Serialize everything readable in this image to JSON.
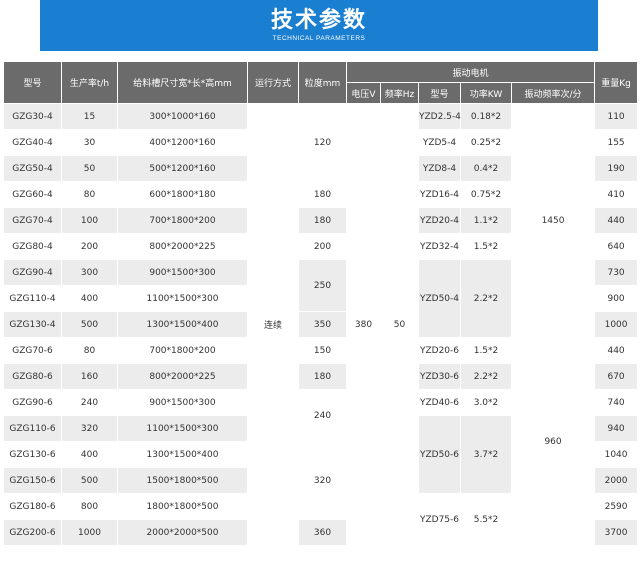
{
  "banner": {
    "title": "技术参数",
    "subtitle": "TECHNICAL PARAMETERS"
  },
  "headers": {
    "model": "型号",
    "capacity": "生产率t/h",
    "trough": "给料槽尺寸宽*长*高mm",
    "mode": "运行方式",
    "granularity": "粒度mm",
    "motor": "振动电机",
    "voltage": "电压V",
    "frequency": "频率Hz",
    "motor_model": "型号",
    "power": "功率KW",
    "vib_freq": "振动频率次/分",
    "weight": "重量Kg"
  },
  "shared": {
    "mode": "连续",
    "voltage": "380",
    "frequency": "50",
    "vib_freq_4": "1450",
    "vib_freq_6": "960"
  },
  "rows": [
    {
      "model": "GZG30-4",
      "capacity": "15",
      "trough": "300*1000*160",
      "weight": "110"
    },
    {
      "model": "GZG40-4",
      "capacity": "30",
      "trough": "400*1200*160",
      "weight": "155"
    },
    {
      "model": "GZG50-4",
      "capacity": "50",
      "trough": "500*1200*160",
      "weight": "190"
    },
    {
      "model": "GZG60-4",
      "capacity": "80",
      "trough": "600*1800*180",
      "weight": "410"
    },
    {
      "model": "GZG70-4",
      "capacity": "100",
      "trough": "700*1800*200",
      "weight": "440"
    },
    {
      "model": "GZG80-4",
      "capacity": "200",
      "trough": "800*2000*225",
      "weight": "640"
    },
    {
      "model": "GZG90-4",
      "capacity": "300",
      "trough": "900*1500*300",
      "weight": "730"
    },
    {
      "model": "GZG110-4",
      "capacity": "400",
      "trough": "1100*1500*300",
      "weight": "900"
    },
    {
      "model": "GZG130-4",
      "capacity": "500",
      "trough": "1300*1500*400",
      "weight": "1000"
    },
    {
      "model": "GZG70-6",
      "capacity": "80",
      "trough": "700*1800*200",
      "weight": "440"
    },
    {
      "model": "GZG80-6",
      "capacity": "160",
      "trough": "800*2000*225",
      "weight": "670"
    },
    {
      "model": "GZG90-6",
      "capacity": "240",
      "trough": "900*1500*300",
      "weight": "740"
    },
    {
      "model": "GZG110-6",
      "capacity": "320",
      "trough": "1100*1500*300",
      "weight": "940"
    },
    {
      "model": "GZG130-6",
      "capacity": "400",
      "trough": "1300*1500*400",
      "weight": "1040"
    },
    {
      "model": "GZG150-6",
      "capacity": "500",
      "trough": "1500*1800*500",
      "weight": "2000"
    },
    {
      "model": "GZG180-6",
      "capacity": "800",
      "trough": "1800*1800*500",
      "weight": "2590"
    },
    {
      "model": "GZG200-6",
      "capacity": "1000",
      "trough": "2000*2000*500",
      "weight": "3700"
    }
  ],
  "granularity_groups": [
    "120",
    "180",
    "180",
    "200",
    "250",
    "350",
    "150",
    "180",
    "240",
    "320",
    "360"
  ],
  "motor_groups": [
    {
      "model": "YZD2.5-4",
      "power": "0.18*2"
    },
    {
      "model": "YZD5-4",
      "power": "0.25*2"
    },
    {
      "model": "YZD8-4",
      "power": "0.4*2"
    },
    {
      "model": "YZD16-4",
      "power": "0.75*2"
    },
    {
      "model": "YZD20-4",
      "power": "1.1*2"
    },
    {
      "model": "YZD32-4",
      "power": "1.5*2"
    },
    {
      "model": "YZD50-4",
      "power": "2.2*2"
    },
    {
      "model": "YZD20-6",
      "power": "1.5*2"
    },
    {
      "model": "YZD30-6",
      "power": "2.2*2"
    },
    {
      "model": "YZD40-6",
      "power": "3.0*2"
    },
    {
      "model": "YZD50-6",
      "power": "3.7*2"
    },
    {
      "model": "YZD75-6",
      "power": "5.5*2"
    }
  ]
}
